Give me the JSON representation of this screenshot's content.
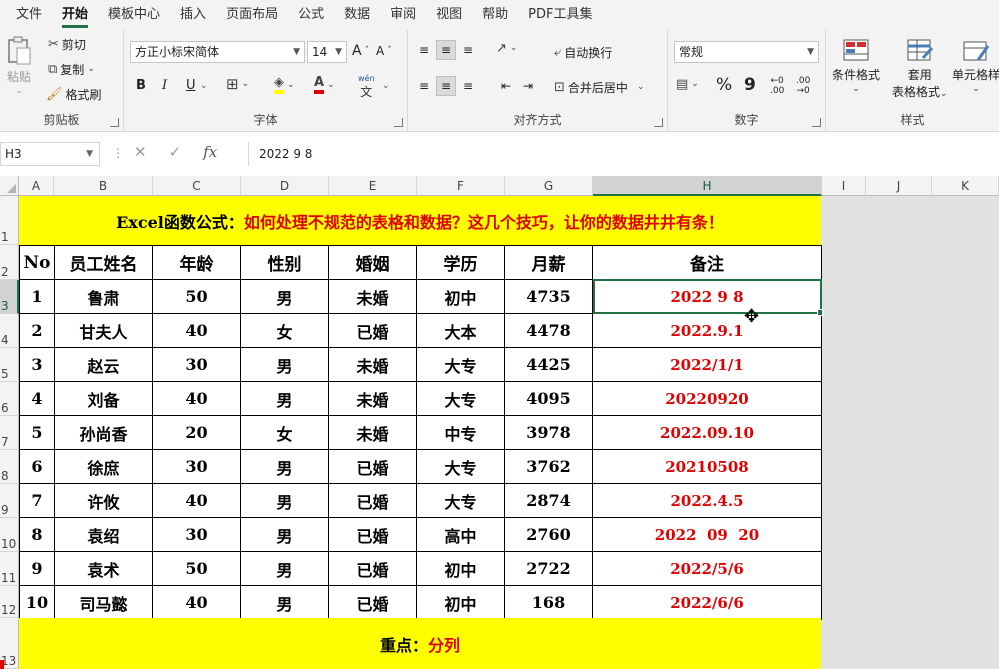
{
  "menu": [
    "文件",
    "开始",
    "模板中心",
    "插入",
    "页面布局",
    "公式",
    "数据",
    "审阅",
    "视图",
    "帮助",
    "PDF工具集"
  ],
  "ribbon": {
    "clipboard": {
      "paste": "粘贴",
      "cut": "剪切",
      "copy": "复制",
      "painter": "格式刷",
      "label": "剪贴板"
    },
    "font": {
      "name": "方正小标宋简体",
      "size": "14",
      "bold": "B",
      "italic": "I",
      "underline": "U",
      "label": "字体",
      "grow": "A",
      "shrink": "A",
      "phonetic": "wén"
    },
    "align": {
      "wrap": "自动换行",
      "merge": "合并后居中",
      "label": "对齐方式"
    },
    "number": {
      "format": "常规",
      "percent": "%",
      "comma": "9",
      "label": "数字",
      "inc": ".00",
      "dec": ".00"
    },
    "styles": {
      "cond": "条件格式",
      "table1": "套用",
      "table2": "表格格式",
      "cell": "单元格样",
      "label": "样式"
    }
  },
  "formula_bar": {
    "cell_ref": "H3",
    "value": "2022 9 8",
    "fx": "fx"
  },
  "columns": [
    "A",
    "B",
    "C",
    "D",
    "E",
    "F",
    "G",
    "H",
    "I",
    "J",
    "K"
  ],
  "rows": [
    "1",
    "2",
    "3",
    "4",
    "5",
    "6",
    "7",
    "8",
    "9",
    "10",
    "11",
    "12",
    "13"
  ],
  "sheet": {
    "title_prefix": "Excel函数公式：",
    "title_main": "如何处理不规范的表格和数据？这几个技巧，让你的数据井井有条！",
    "headers": [
      "No",
      "员工姓名",
      "年龄",
      "性别",
      "婚姻",
      "学历",
      "月薪",
      "备注"
    ],
    "records": [
      [
        "1",
        "鲁肃",
        "50",
        "男",
        "未婚",
        "初中",
        "4735",
        "2022 9 8"
      ],
      [
        "2",
        "甘夫人",
        "40",
        "女",
        "已婚",
        "大本",
        "4478",
        "2022.9.1"
      ],
      [
        "3",
        "赵云",
        "30",
        "男",
        "未婚",
        "大专",
        "4425",
        "2022/1/1"
      ],
      [
        "4",
        "刘备",
        "40",
        "男",
        "未婚",
        "大专",
        "4095",
        "20220920"
      ],
      [
        "5",
        "孙尚香",
        "20",
        "女",
        "未婚",
        "中专",
        "3978",
        "2022.09.10"
      ],
      [
        "6",
        "徐庶",
        "30",
        "男",
        "已婚",
        "大专",
        "3762",
        "20210508"
      ],
      [
        "7",
        "许攸",
        "40",
        "男",
        "已婚",
        "大专",
        "2874",
        "2022.4.5"
      ],
      [
        "8",
        "袁绍",
        "30",
        "男",
        "已婚",
        "高中",
        "2760",
        "2022  09  20"
      ],
      [
        "9",
        "袁术",
        "50",
        "男",
        "已婚",
        "初中",
        "2722",
        "2022/5/6"
      ],
      [
        "10",
        "司马懿",
        "40",
        "男",
        "已婚",
        "初中",
        "168",
        "2022/6/6"
      ]
    ],
    "footer_prefix": "重点：",
    "footer_main": "分列"
  }
}
